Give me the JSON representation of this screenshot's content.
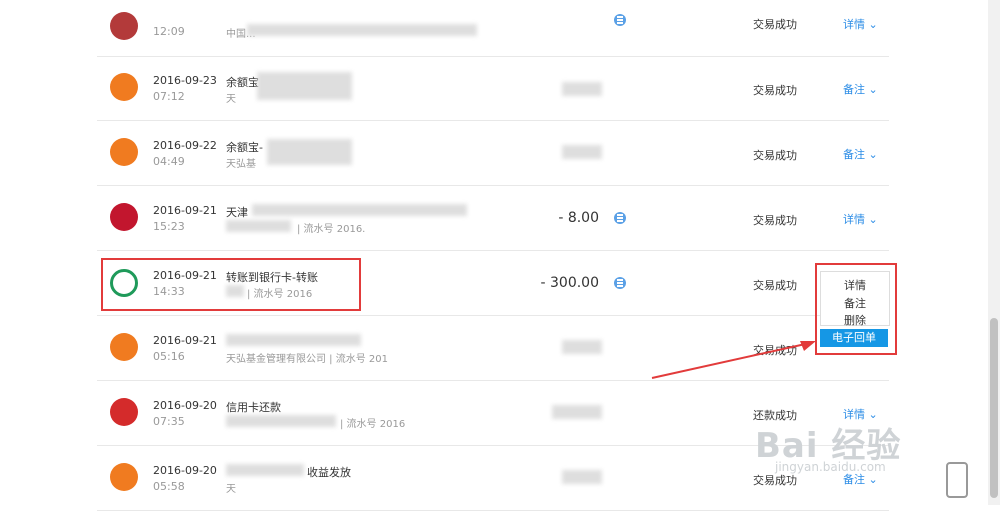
{
  "rows": [
    {
      "date": "",
      "time": "12:09",
      "title": "",
      "sub": "中国...",
      "amount": "",
      "status": "交易成功",
      "action": "详情 ⌄",
      "icon": "bank-red-icon"
    },
    {
      "date": "2016-09-23",
      "time": "07:12",
      "title": "余额宝",
      "sub": "天",
      "amount": "",
      "status": "交易成功",
      "action": "备注 ⌄",
      "icon": "money-bag-icon"
    },
    {
      "date": "2016-09-22",
      "time": "04:49",
      "title": "余额宝-",
      "sub": "天弘基",
      "amount": "",
      "status": "交易成功",
      "action": "备注 ⌄",
      "icon": "money-bag-icon"
    },
    {
      "date": "2016-09-21",
      "time": "15:23",
      "title": "天津",
      "sub": "| 流水号 2016.",
      "amount": "- 8.00",
      "status": "交易成功",
      "action": "详情 ⌄",
      "icon": "tmall-icon"
    },
    {
      "date": "2016-09-21",
      "time": "14:33",
      "title": "转账到银行卡-转账",
      "sub": "| 流水号 2016",
      "amount": "- 300.00",
      "status": "交易成功",
      "action": "",
      "icon": "abc-bank-icon"
    },
    {
      "date": "2016-09-21",
      "time": "05:16",
      "title": "",
      "sub": "天弘基金管理有限公司 | 流水号 201",
      "amount": "",
      "status": "交易成功",
      "action": "",
      "icon": "money-bag-icon"
    },
    {
      "date": "2016-09-20",
      "time": "07:35",
      "title": "信用卡还款",
      "sub": "| 流水号 2016",
      "amount": "",
      "status": "还款成功",
      "action": "详情 ⌄",
      "icon": "cmb-icon"
    },
    {
      "date": "2016-09-20",
      "time": "05:58",
      "title": "收益发放",
      "sub": "天",
      "amount": "",
      "status": "交易成功",
      "action": "备注 ⌄",
      "icon": "money-bag-icon"
    }
  ],
  "menu": {
    "detail": "详情",
    "note": "备注",
    "delete": "删除",
    "receipt": "电子回单"
  },
  "watermark": {
    "brand": "Bai 经验",
    "url": "jingyan.baidu.com"
  },
  "colors": {
    "link": "#2b8ce6",
    "highlight": "#e23b3b",
    "button": "#1597e5"
  }
}
